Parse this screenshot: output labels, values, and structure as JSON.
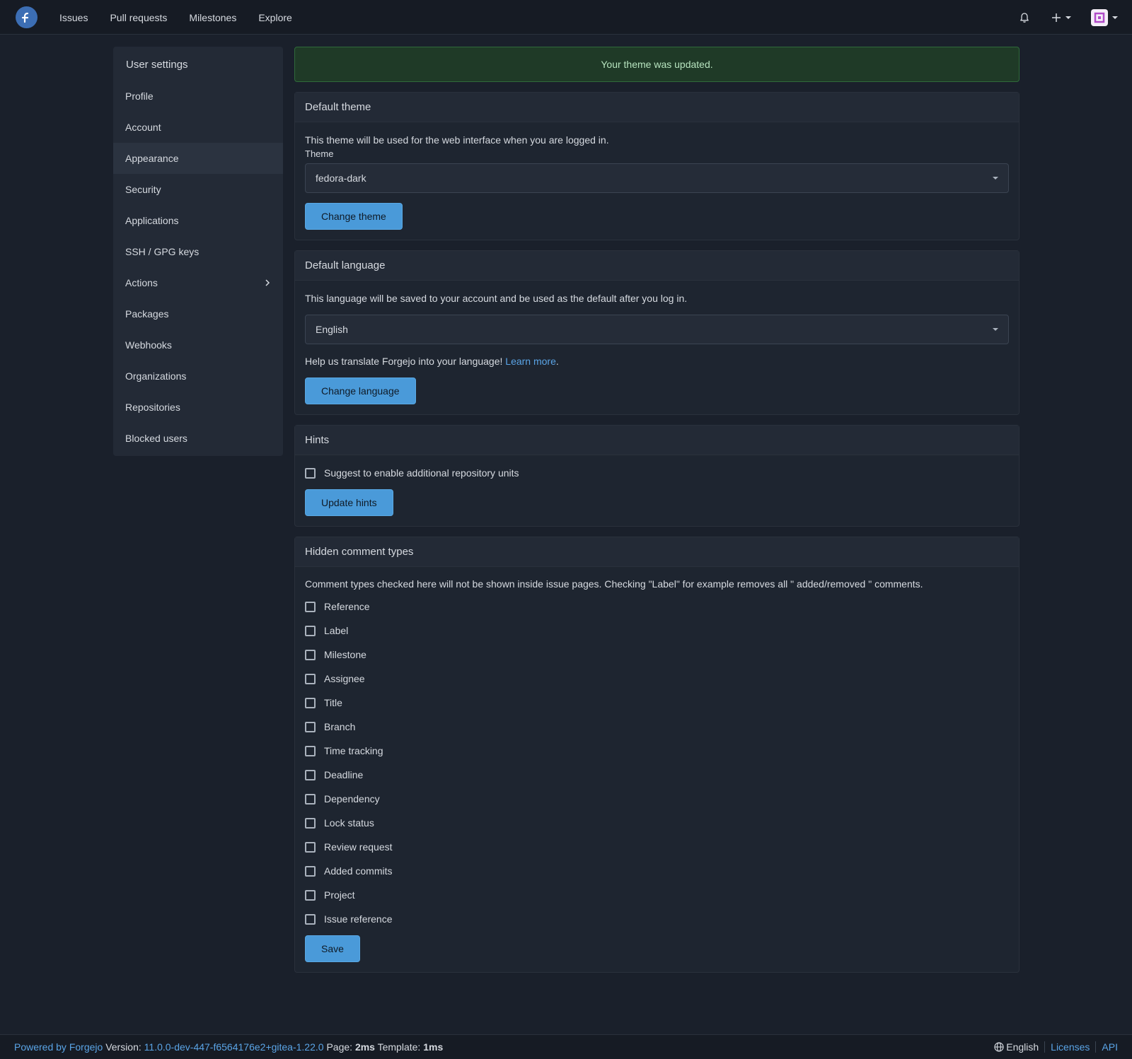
{
  "nav": {
    "links": [
      "Issues",
      "Pull requests",
      "Milestones",
      "Explore"
    ],
    "notification_icon": "bell-icon",
    "create_icon": "plus-icon"
  },
  "sidebar": {
    "title": "User settings",
    "items": [
      {
        "label": "Profile"
      },
      {
        "label": "Account"
      },
      {
        "label": "Appearance",
        "active": true
      },
      {
        "label": "Security"
      },
      {
        "label": "Applications"
      },
      {
        "label": "SSH / GPG keys"
      },
      {
        "label": "Actions",
        "has_submenu": true
      },
      {
        "label": "Packages"
      },
      {
        "label": "Webhooks"
      },
      {
        "label": "Organizations"
      },
      {
        "label": "Repositories"
      },
      {
        "label": "Blocked users"
      }
    ]
  },
  "flash": "Your theme was updated.",
  "theme": {
    "header": "Default theme",
    "description": "This theme will be used for the web interface when you are logged in.",
    "label": "Theme",
    "value": "fedora-dark",
    "button": "Change theme"
  },
  "language": {
    "header": "Default language",
    "description": "This language will be saved to your account and be used as the default after you log in.",
    "value": "English",
    "help_text": "Help us translate Forgejo into your language! ",
    "help_link": "Learn more",
    "help_suffix": ".",
    "button": "Change language"
  },
  "hints": {
    "header": "Hints",
    "checkbox": "Suggest to enable additional repository units",
    "button": "Update hints"
  },
  "hidden_comments": {
    "header": "Hidden comment types",
    "description": "Comment types checked here will not be shown inside issue pages. Checking \"Label\" for example removes all \" added/removed \" comments.",
    "types": [
      "Reference",
      "Label",
      "Milestone",
      "Assignee",
      "Title",
      "Branch",
      "Time tracking",
      "Deadline",
      "Dependency",
      "Lock status",
      "Review request",
      "Added commits",
      "Project",
      "Issue reference"
    ],
    "button": "Save"
  },
  "footer": {
    "powered_by": "Powered by Forgejo",
    "version_label": "Version:",
    "version": "11.0.0-dev-447-f6564176e2+gitea-1.22.0",
    "page_label": "Page:",
    "page_time": "2ms",
    "template_label": "Template:",
    "template_time": "1ms",
    "language": "English",
    "licenses": "Licenses",
    "api": "API"
  },
  "colors": {
    "accent": "#4a9ad9",
    "background": "#1a202b",
    "success_bg": "#1f3a27",
    "success_text": "#b7e4bf"
  }
}
